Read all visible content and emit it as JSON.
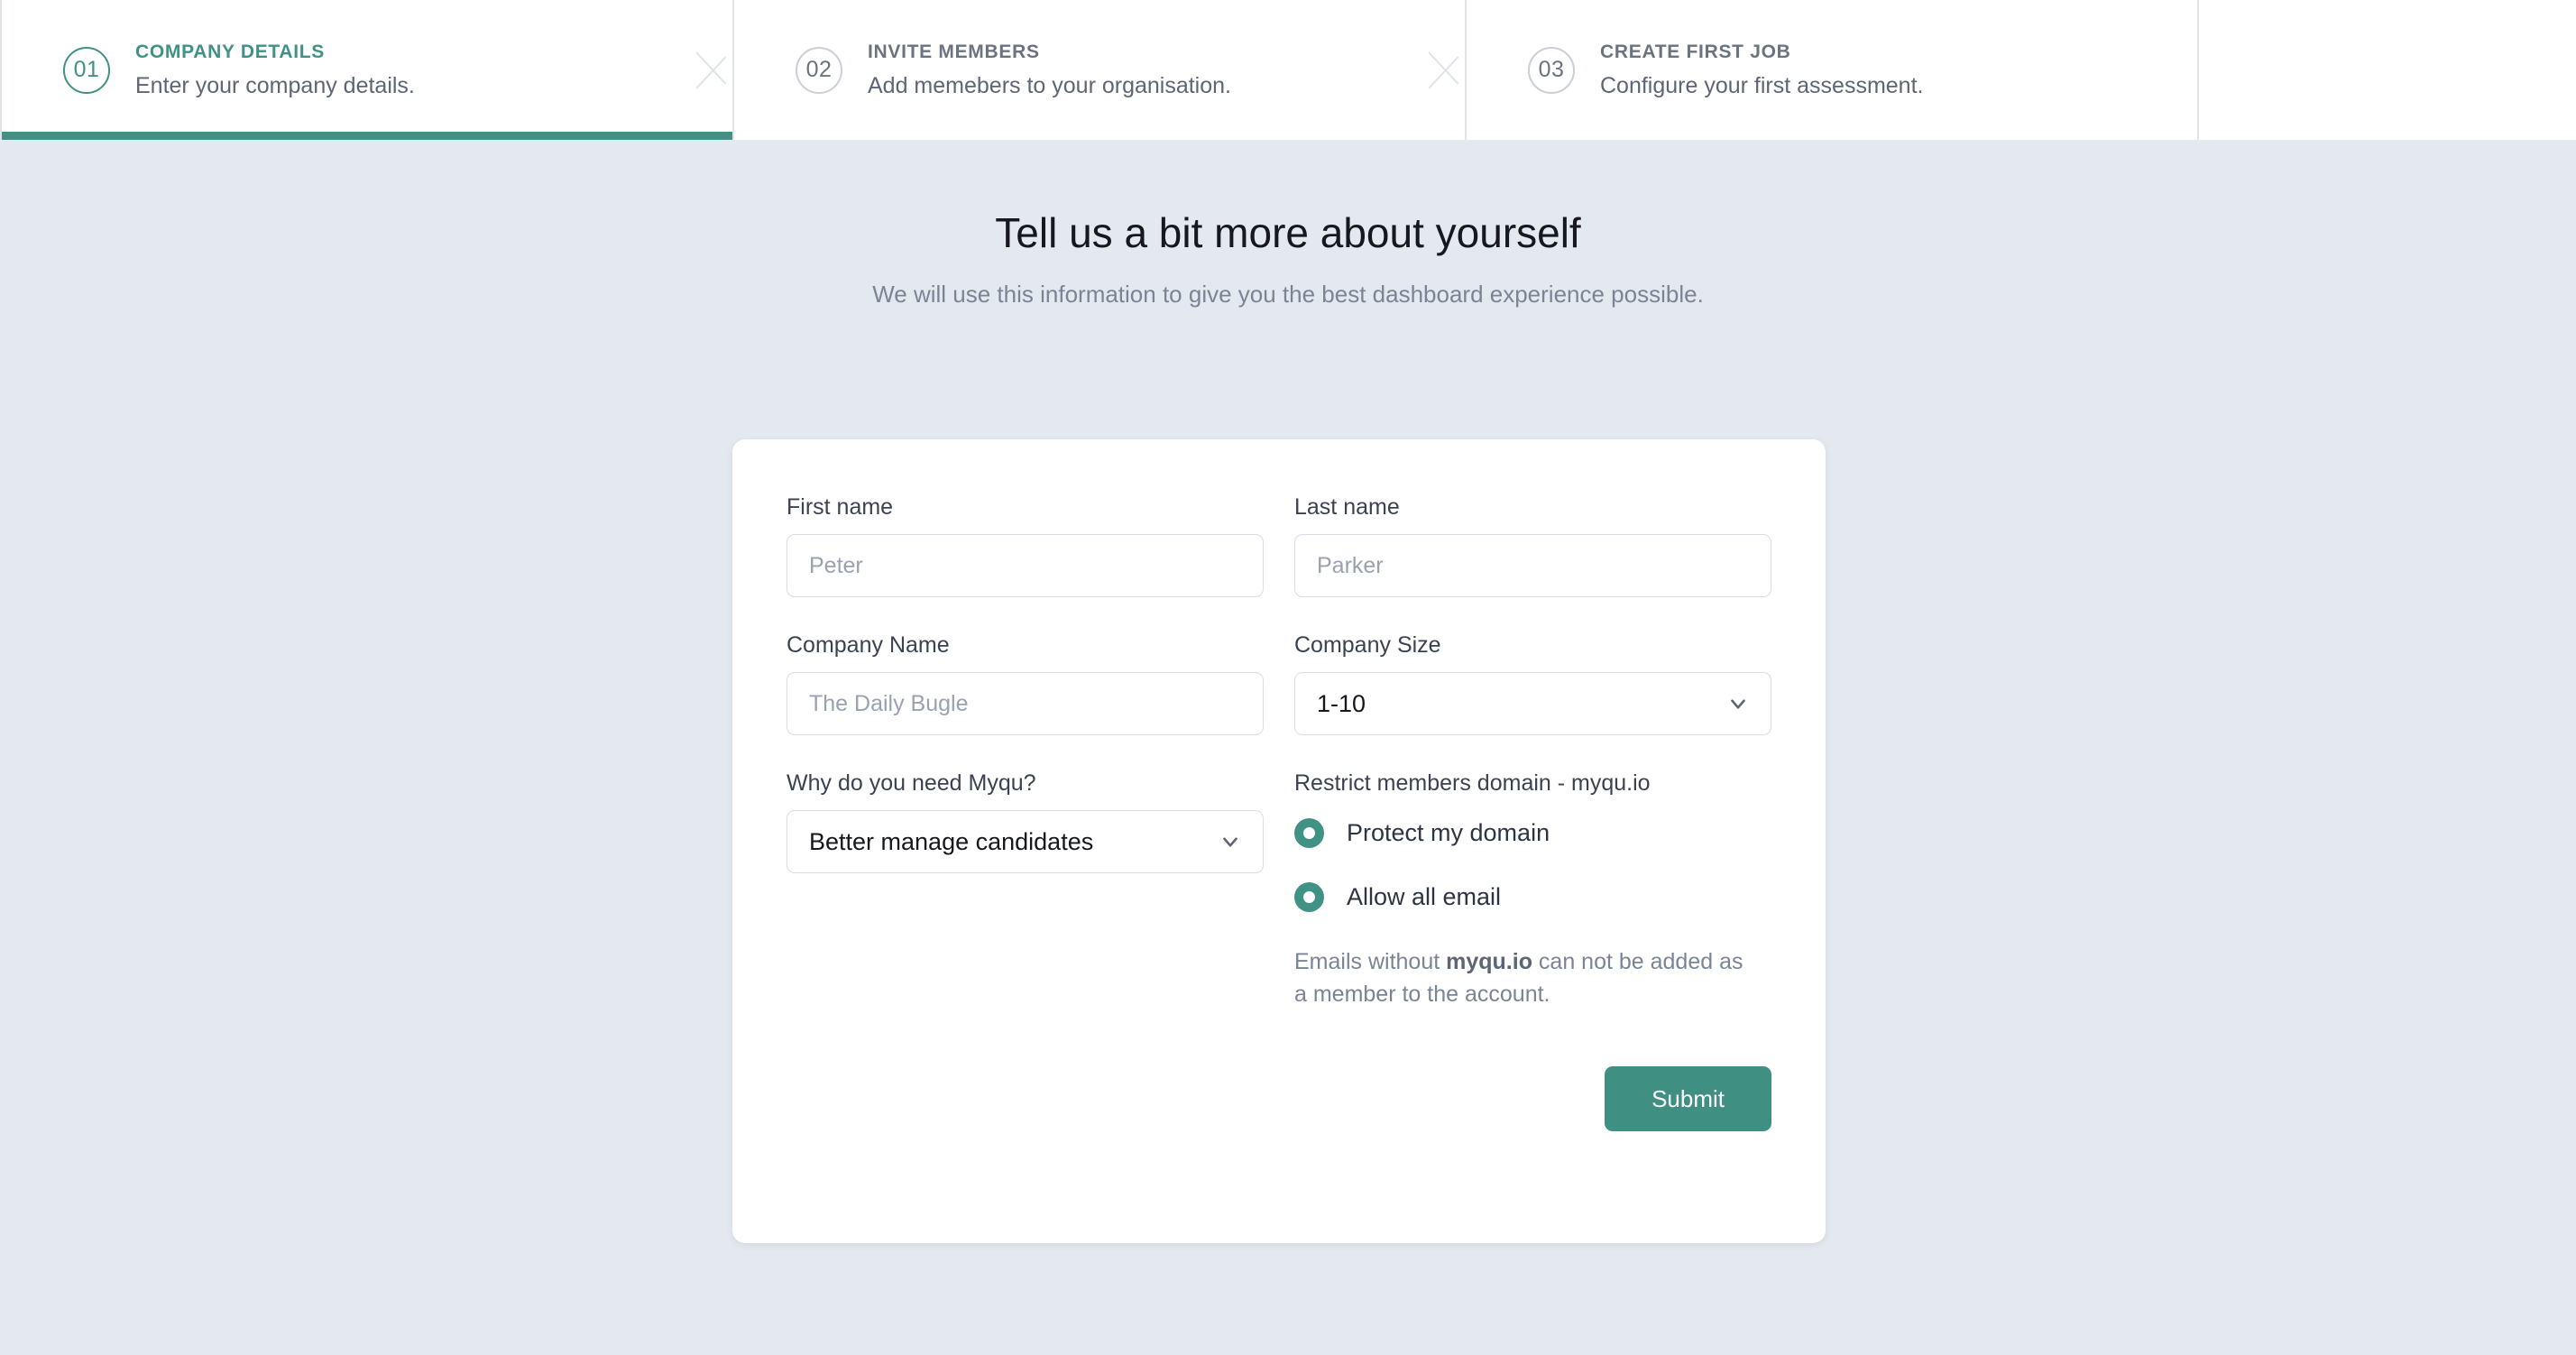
{
  "stepper": {
    "steps": [
      {
        "number": "01",
        "title": "COMPANY DETAILS",
        "subtitle": "Enter your company details.",
        "state": "active"
      },
      {
        "number": "02",
        "title": "INVITE MEMBERS",
        "subtitle": "Add memebers to your organisation.",
        "state": "inactive"
      },
      {
        "number": "03",
        "title": "CREATE FIRST JOB",
        "subtitle": "Configure your first assessment.",
        "state": "inactive"
      }
    ]
  },
  "page": {
    "heading": "Tell us a bit more about yourself",
    "subheading": "We will use this information to give you the best dashboard experience possible."
  },
  "form": {
    "first_name": {
      "label": "First name",
      "value": "",
      "placeholder": "Peter"
    },
    "last_name": {
      "label": "Last name",
      "value": "",
      "placeholder": "Parker"
    },
    "company_name": {
      "label": "Company Name",
      "value": "",
      "placeholder": "The Daily Bugle"
    },
    "company_size": {
      "label": "Company Size",
      "selected": "1-10",
      "icon": "chevron-down-icon"
    },
    "why_myqu": {
      "label": "Why do you need Myqu?",
      "selected": "Better manage candidates",
      "icon": "chevron-down-icon"
    },
    "restrict_domain": {
      "label": "Restrict members domain - myqu.io",
      "options": [
        {
          "label": "Protect my domain",
          "selected": true
        },
        {
          "label": "Allow all email",
          "selected": true
        }
      ],
      "helper_prefix": "Emails without ",
      "helper_strong": "myqu.io",
      "helper_suffix": " can not be added as a member to the account."
    },
    "submit_label": "Submit"
  },
  "colors": {
    "accent": "#409285",
    "submit": "#3f8f82",
    "background": "#e4e8ef",
    "card": "#ffffff",
    "border": "#d8dde5",
    "muted_text": "#7b8496"
  }
}
